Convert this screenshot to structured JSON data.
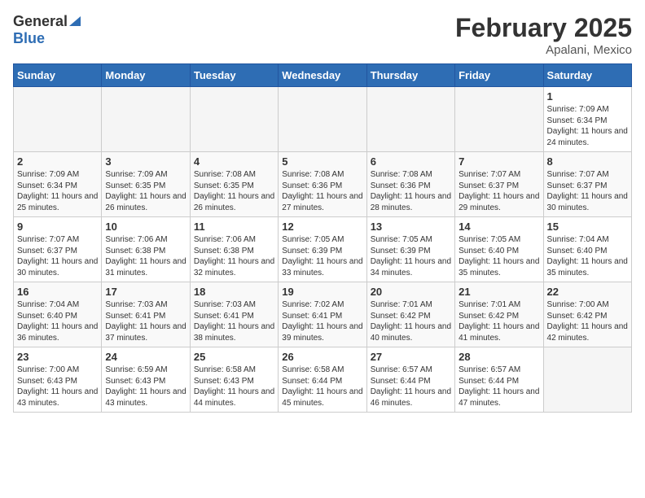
{
  "header": {
    "logo_general": "General",
    "logo_blue": "Blue",
    "title": "February 2025",
    "location": "Apalani, Mexico"
  },
  "calendar": {
    "weekdays": [
      "Sunday",
      "Monday",
      "Tuesday",
      "Wednesday",
      "Thursday",
      "Friday",
      "Saturday"
    ],
    "weeks": [
      [
        {
          "day": "",
          "empty": true
        },
        {
          "day": "",
          "empty": true
        },
        {
          "day": "",
          "empty": true
        },
        {
          "day": "",
          "empty": true
        },
        {
          "day": "",
          "empty": true
        },
        {
          "day": "",
          "empty": true
        },
        {
          "day": "1",
          "sunrise": "7:09 AM",
          "sunset": "6:34 PM",
          "daylight": "11 hours and 24 minutes."
        }
      ],
      [
        {
          "day": "2",
          "sunrise": "7:09 AM",
          "sunset": "6:34 PM",
          "daylight": "11 hours and 25 minutes."
        },
        {
          "day": "3",
          "sunrise": "7:09 AM",
          "sunset": "6:35 PM",
          "daylight": "11 hours and 26 minutes."
        },
        {
          "day": "4",
          "sunrise": "7:08 AM",
          "sunset": "6:35 PM",
          "daylight": "11 hours and 26 minutes."
        },
        {
          "day": "5",
          "sunrise": "7:08 AM",
          "sunset": "6:36 PM",
          "daylight": "11 hours and 27 minutes."
        },
        {
          "day": "6",
          "sunrise": "7:08 AM",
          "sunset": "6:36 PM",
          "daylight": "11 hours and 28 minutes."
        },
        {
          "day": "7",
          "sunrise": "7:07 AM",
          "sunset": "6:37 PM",
          "daylight": "11 hours and 29 minutes."
        },
        {
          "day": "8",
          "sunrise": "7:07 AM",
          "sunset": "6:37 PM",
          "daylight": "11 hours and 30 minutes."
        }
      ],
      [
        {
          "day": "9",
          "sunrise": "7:07 AM",
          "sunset": "6:37 PM",
          "daylight": "11 hours and 30 minutes."
        },
        {
          "day": "10",
          "sunrise": "7:06 AM",
          "sunset": "6:38 PM",
          "daylight": "11 hours and 31 minutes."
        },
        {
          "day": "11",
          "sunrise": "7:06 AM",
          "sunset": "6:38 PM",
          "daylight": "11 hours and 32 minutes."
        },
        {
          "day": "12",
          "sunrise": "7:05 AM",
          "sunset": "6:39 PM",
          "daylight": "11 hours and 33 minutes."
        },
        {
          "day": "13",
          "sunrise": "7:05 AM",
          "sunset": "6:39 PM",
          "daylight": "11 hours and 34 minutes."
        },
        {
          "day": "14",
          "sunrise": "7:05 AM",
          "sunset": "6:40 PM",
          "daylight": "11 hours and 35 minutes."
        },
        {
          "day": "15",
          "sunrise": "7:04 AM",
          "sunset": "6:40 PM",
          "daylight": "11 hours and 35 minutes."
        }
      ],
      [
        {
          "day": "16",
          "sunrise": "7:04 AM",
          "sunset": "6:40 PM",
          "daylight": "11 hours and 36 minutes."
        },
        {
          "day": "17",
          "sunrise": "7:03 AM",
          "sunset": "6:41 PM",
          "daylight": "11 hours and 37 minutes."
        },
        {
          "day": "18",
          "sunrise": "7:03 AM",
          "sunset": "6:41 PM",
          "daylight": "11 hours and 38 minutes."
        },
        {
          "day": "19",
          "sunrise": "7:02 AM",
          "sunset": "6:41 PM",
          "daylight": "11 hours and 39 minutes."
        },
        {
          "day": "20",
          "sunrise": "7:01 AM",
          "sunset": "6:42 PM",
          "daylight": "11 hours and 40 minutes."
        },
        {
          "day": "21",
          "sunrise": "7:01 AM",
          "sunset": "6:42 PM",
          "daylight": "11 hours and 41 minutes."
        },
        {
          "day": "22",
          "sunrise": "7:00 AM",
          "sunset": "6:42 PM",
          "daylight": "11 hours and 42 minutes."
        }
      ],
      [
        {
          "day": "23",
          "sunrise": "7:00 AM",
          "sunset": "6:43 PM",
          "daylight": "11 hours and 43 minutes."
        },
        {
          "day": "24",
          "sunrise": "6:59 AM",
          "sunset": "6:43 PM",
          "daylight": "11 hours and 43 minutes."
        },
        {
          "day": "25",
          "sunrise": "6:58 AM",
          "sunset": "6:43 PM",
          "daylight": "11 hours and 44 minutes."
        },
        {
          "day": "26",
          "sunrise": "6:58 AM",
          "sunset": "6:44 PM",
          "daylight": "11 hours and 45 minutes."
        },
        {
          "day": "27",
          "sunrise": "6:57 AM",
          "sunset": "6:44 PM",
          "daylight": "11 hours and 46 minutes."
        },
        {
          "day": "28",
          "sunrise": "6:57 AM",
          "sunset": "6:44 PM",
          "daylight": "11 hours and 47 minutes."
        },
        {
          "day": "",
          "empty": true
        }
      ]
    ]
  }
}
